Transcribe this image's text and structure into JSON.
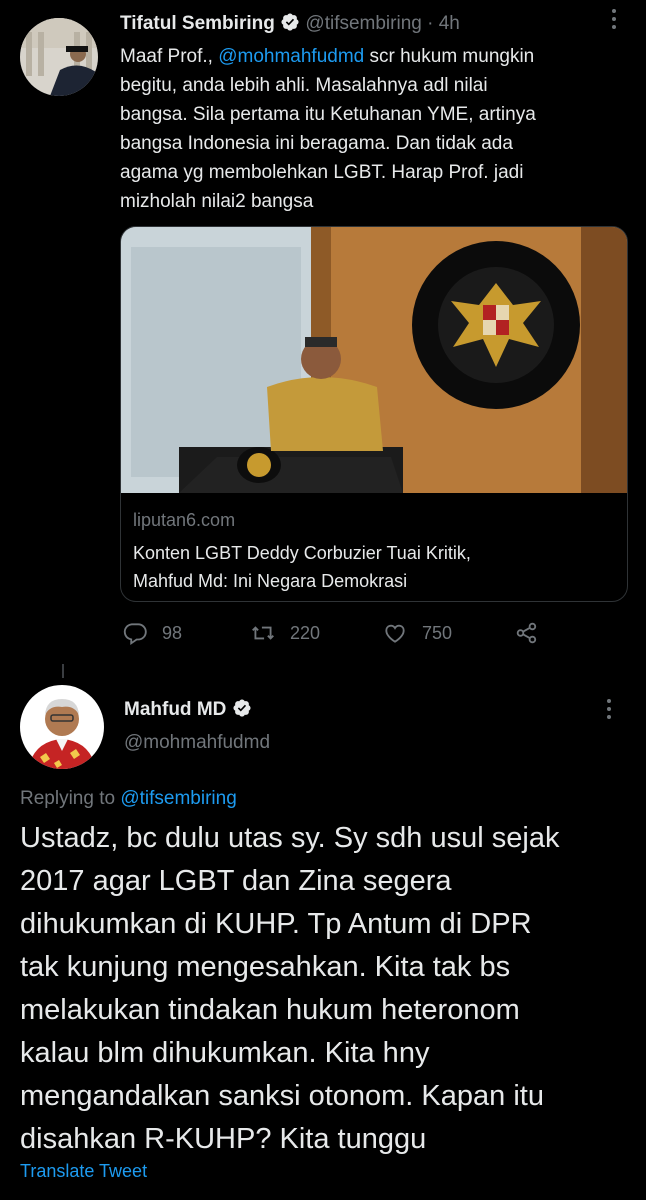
{
  "tweet1": {
    "author_name": "Tifatul Sembiring",
    "handle": "@tifsembiring",
    "separator": "·",
    "time": "4h",
    "text_prefix": "Maaf Prof., ",
    "mention": "@mohmahfudmd",
    "text_lines": [
      " scr hukum mungkin",
      "begitu, anda lebih ahli. Masalahnya adl nilai",
      "bangsa. Sila pertama itu Ketuhanan YME, artinya",
      "bangsa Indonesia ini beragama. Dan tidak ada",
      "agama yg membolehkan LGBT. Harap Prof. jadi",
      "mizholah nilai2 bangsa"
    ],
    "card": {
      "domain": "liputan6.com",
      "title_line1": "Konten LGBT Deddy Corbuzier Tuai Kritik,",
      "title_line2": "Mahfud Md: Ini Negara Demokrasi",
      "seal_text": "MENKO POLHUKAM",
      "seal_text_bottom": "REPUBLIK INDONESIA"
    },
    "actions": {
      "replies": "98",
      "retweets": "220",
      "likes": "750"
    }
  },
  "tweet2": {
    "author_name": "Mahfud MD",
    "handle": "@mohmahfudmd",
    "replying_label": "Replying to ",
    "replying_to": "@tifsembiring",
    "text_lines": [
      "Ustadz, bc dulu utas sy. Sy sdh usul sejak",
      "2017 agar LGBT dan Zina segera",
      "dihukumkan di KUHP. Tp Antum di DPR",
      "tak kunjung mengesahkan. Kita tak bs",
      "melakukan tindakan hukum heteronom",
      "kalau blm dihukumkan. Kita hny",
      "mengandalkan sanksi otonom. Kapan itu",
      "disahkan R-KUHP? Kita tunggu"
    ],
    "translate": "Translate Tweet"
  },
  "colors": {
    "background": "#000000",
    "text": "#e7e9ea",
    "muted": "#71767b",
    "link": "#1d9bf0",
    "border": "#2f3336"
  },
  "icons": [
    "verified-badge-icon",
    "more-icon",
    "reply-icon",
    "retweet-icon",
    "like-icon",
    "share-icon"
  ]
}
